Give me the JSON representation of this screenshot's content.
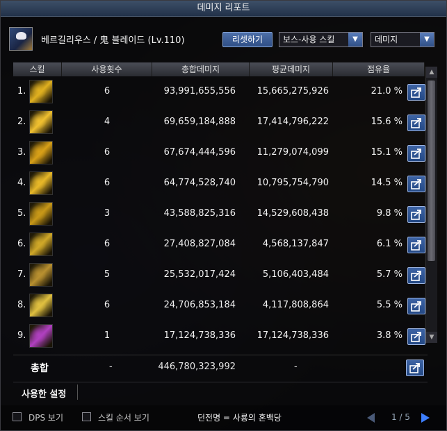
{
  "window": {
    "title": "데미지 리포트"
  },
  "character": {
    "name_line": "베르길리우스 / 鬼 블레이드 (Lv.110)"
  },
  "controls": {
    "reset_label": "리셋하기",
    "filter_value": "보스-사용 스킬",
    "metric_value": "데미지"
  },
  "table": {
    "headers": [
      "스킬",
      "사용횟수",
      "총합데미지",
      "평균데미지",
      "점유율"
    ],
    "rows": [
      {
        "rank": "1.",
        "uses": "6",
        "total": "93,991,655,556",
        "avg": "15,665,275,926",
        "share": "21.0 %",
        "share_value": 21.0,
        "icon_color": "#e0b020"
      },
      {
        "rank": "2.",
        "uses": "4",
        "total": "69,659,184,888",
        "avg": "17,414,796,222",
        "share": "15.6 %",
        "share_value": 15.6,
        "icon_color": "#f0c030"
      },
      {
        "rank": "3.",
        "uses": "6",
        "total": "67,674,444,596",
        "avg": "11,279,074,099",
        "share": "15.1 %",
        "share_value": 15.1,
        "icon_color": "#d8a018"
      },
      {
        "rank": "4.",
        "uses": "6",
        "total": "64,774,528,740",
        "avg": "10,795,754,790",
        "share": "14.5 %",
        "share_value": 14.5,
        "icon_color": "#e8b828"
      },
      {
        "rank": "5.",
        "uses": "3",
        "total": "43,588,825,316",
        "avg": "14,529,608,438",
        "share": "9.8 %",
        "share_value": 9.8,
        "icon_color": "#c89818"
      },
      {
        "rank": "6.",
        "uses": "6",
        "total": "27,408,827,084",
        "avg": "4,568,137,847",
        "share": "6.1 %",
        "share_value": 6.1,
        "icon_color": "#d0a828"
      },
      {
        "rank": "7.",
        "uses": "5",
        "total": "25,532,017,424",
        "avg": "5,106,403,484",
        "share": "5.7 %",
        "share_value": 5.7,
        "icon_color": "#b89030"
      },
      {
        "rank": "8.",
        "uses": "6",
        "total": "24,706,853,184",
        "avg": "4,117,808,864",
        "share": "5.5 %",
        "share_value": 5.5,
        "icon_color": "#e0c040"
      },
      {
        "rank": "9.",
        "uses": "1",
        "total": "17,124,738,336",
        "avg": "17,124,738,336",
        "share": "3.8 %",
        "share_value": 3.8,
        "icon_color": "#b040c0"
      }
    ]
  },
  "summary": {
    "label": "총합",
    "uses": "-",
    "total": "446,780,323,992",
    "avg": "-"
  },
  "settings": {
    "label": "사용한 설정"
  },
  "footer": {
    "dps_label": "DPS 보기",
    "order_label": "스킬 순서 보기",
    "dungeon_text": "던전명 = 사룡의 혼백당",
    "page_text": "1 / 5"
  },
  "colors": {
    "title_bar": "#2d3f58",
    "button_blue": "#2f4f86",
    "pager_active": "#3d7fff"
  },
  "icons": {
    "share": "share-export-icon",
    "dropdown": "chevron-down-icon",
    "scroll_up": "chevron-up-icon",
    "scroll_down": "chevron-down-icon"
  }
}
